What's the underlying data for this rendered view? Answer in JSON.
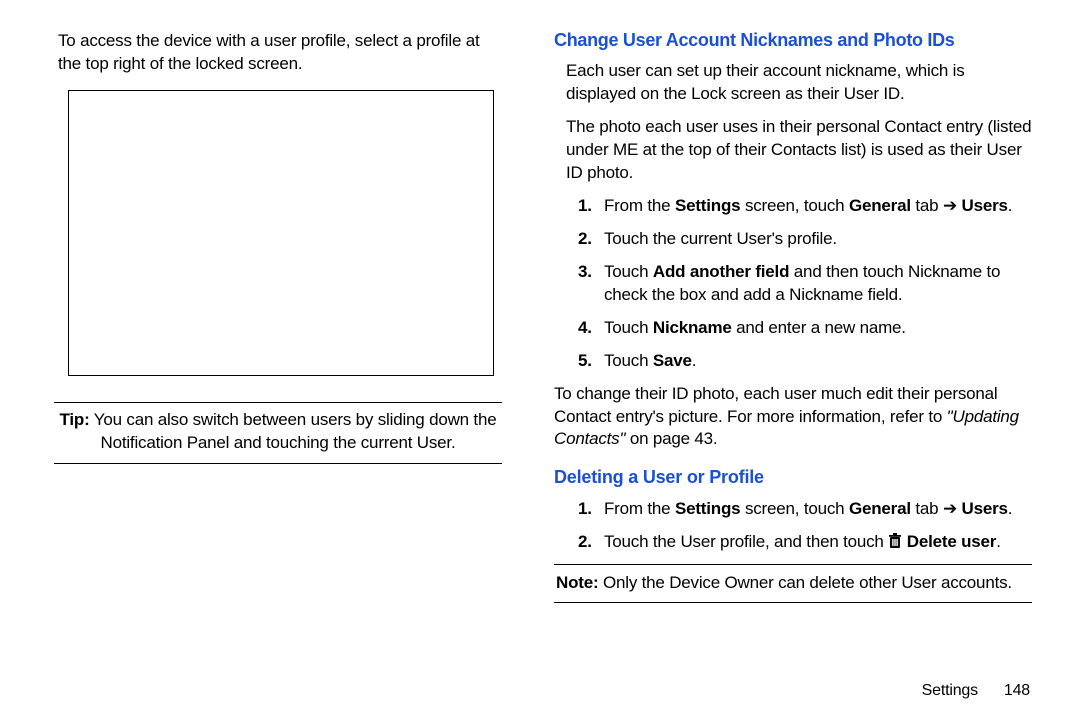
{
  "left": {
    "intro": "To access the device with a user profile, select a profile at the top right of the locked screen.",
    "tip_label": "Tip:",
    "tip_body": " You can also switch between users by sliding down the Notification Panel and touching the current User."
  },
  "right": {
    "heading1": "Change User Account Nicknames and Photo IDs",
    "p1": "Each user can set up their account nickname, which is displayed on the Lock screen as their User ID.",
    "p2": "The photo each user uses in their personal Contact entry (listed under ME at the top of their Contacts list) is used as their User ID photo.",
    "steps1": {
      "s1_a": "From the ",
      "s1_b": "Settings",
      "s1_c": " screen, touch ",
      "s1_d": "General",
      "s1_e": " tab ",
      "s1_f": "➔",
      "s1_g": "Users",
      "s1_h": ".",
      "s2": "Touch the current User's profile.",
      "s3_a": "Touch ",
      "s3_b": "Add another field",
      "s3_c": " and then touch Nickname to check the box and add a Nickname field.",
      "s4_a": "Touch ",
      "s4_b": "Nickname",
      "s4_c": " and enter a new name.",
      "s5_a": "Touch ",
      "s5_b": "Save",
      "s5_c": "."
    },
    "p3_a": "To change their ID photo, each user much edit their personal Contact entry's picture. For more information, refer to ",
    "p3_link": "\"Updating Contacts\"",
    "p3_b": " on page 43.",
    "heading2": "Deleting a User or Profile",
    "steps2": {
      "s1_a": "From the ",
      "s1_b": "Settings",
      "s1_c": " screen, touch ",
      "s1_d": "General",
      "s1_e": " tab ",
      "s1_f": "➔",
      "s1_g": "Users",
      "s1_h": ".",
      "s2_a": "Touch the User profile, and then touch ",
      "s2_b": "Delete user",
      "s2_c": "."
    },
    "note_label": "Note:",
    "note_body": " Only the Device Owner can delete other User accounts."
  },
  "footer": {
    "section": "Settings",
    "page": "148"
  }
}
